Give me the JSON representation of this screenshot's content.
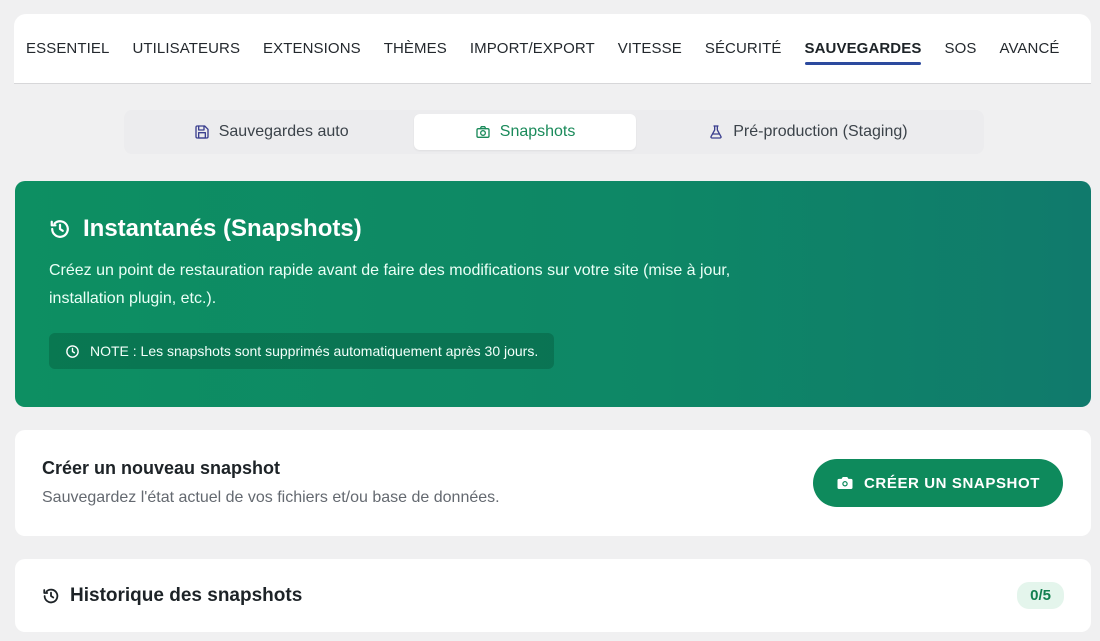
{
  "topnav": {
    "items": [
      {
        "label": "ESSENTIEL"
      },
      {
        "label": "UTILISATEURS"
      },
      {
        "label": "EXTENSIONS"
      },
      {
        "label": "THÈMES"
      },
      {
        "label": "IMPORT/EXPORT"
      },
      {
        "label": "VITESSE"
      },
      {
        "label": "SÉCURITÉ"
      },
      {
        "label": "SAUVEGARDES"
      },
      {
        "label": "SOS"
      },
      {
        "label": "AVANCÉ"
      }
    ],
    "active": "SAUVEGARDES"
  },
  "subtabs": {
    "items": [
      {
        "label": "Sauvegardes auto",
        "icon": "floppy-disk-icon"
      },
      {
        "label": "Snapshots",
        "icon": "camera-icon"
      },
      {
        "label": "Pré-production (Staging)",
        "icon": "flask-icon"
      }
    ],
    "active": "Snapshots"
  },
  "hero": {
    "title": "Instantanés (Snapshots)",
    "description": "Créez un point de restauration rapide avant de faire des modifications sur votre site (mise à jour, installation plugin, etc.).",
    "note": "NOTE : Les snapshots sont supprimés automatiquement après 30 jours."
  },
  "create": {
    "title": "Créer un nouveau snapshot",
    "subtitle": "Sauvegardez l'état actuel de vos fichiers et/ou base de données.",
    "button_label": "CRÉER UN SNAPSHOT"
  },
  "history": {
    "title": "Historique des snapshots",
    "count": "0/5"
  },
  "colors": {
    "accent_green": "#0e8a5c",
    "active_underline": "#2c4a9e",
    "hero_gradient_start": "#0d8f62",
    "hero_gradient_end": "#107a6c"
  }
}
